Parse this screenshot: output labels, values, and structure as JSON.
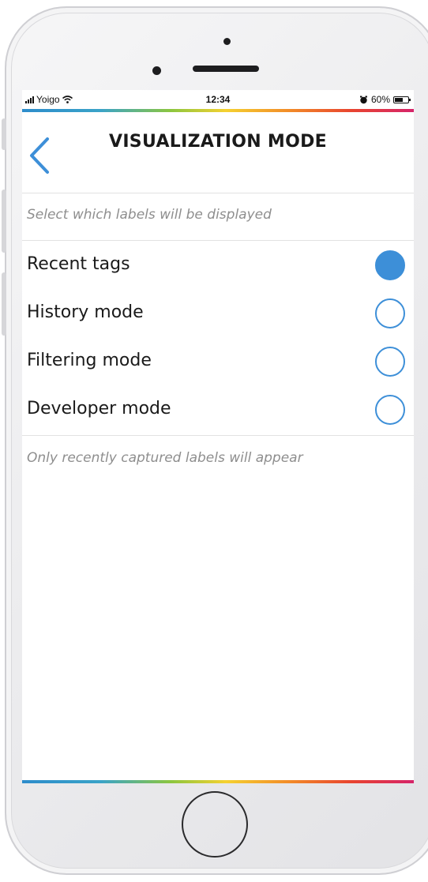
{
  "status_bar": {
    "carrier": "Yoigo",
    "time": "12:34",
    "battery": "60%",
    "battery_level": 0.6,
    "icons": [
      "signal-icon",
      "wifi-icon",
      "alarm-icon",
      "battery-icon"
    ]
  },
  "header": {
    "back_icon": "chevron-left-icon",
    "title": "VISUALIZATION MODE"
  },
  "instructions": "Select which labels will be displayed",
  "options": [
    {
      "label": "Recent tags",
      "selected": true
    },
    {
      "label": "History mode",
      "selected": false
    },
    {
      "label": "Filtering mode",
      "selected": false
    },
    {
      "label": "Developer mode",
      "selected": false
    }
  ],
  "description": "Only recently captured labels will appear",
  "colors": {
    "accent": "#3d8fd8",
    "hint_text": "#8e8e8e",
    "rainbow": [
      "#2d8ccb",
      "#8cc63f",
      "#f5d130",
      "#f28c28",
      "#e8442f",
      "#d6246a"
    ]
  }
}
